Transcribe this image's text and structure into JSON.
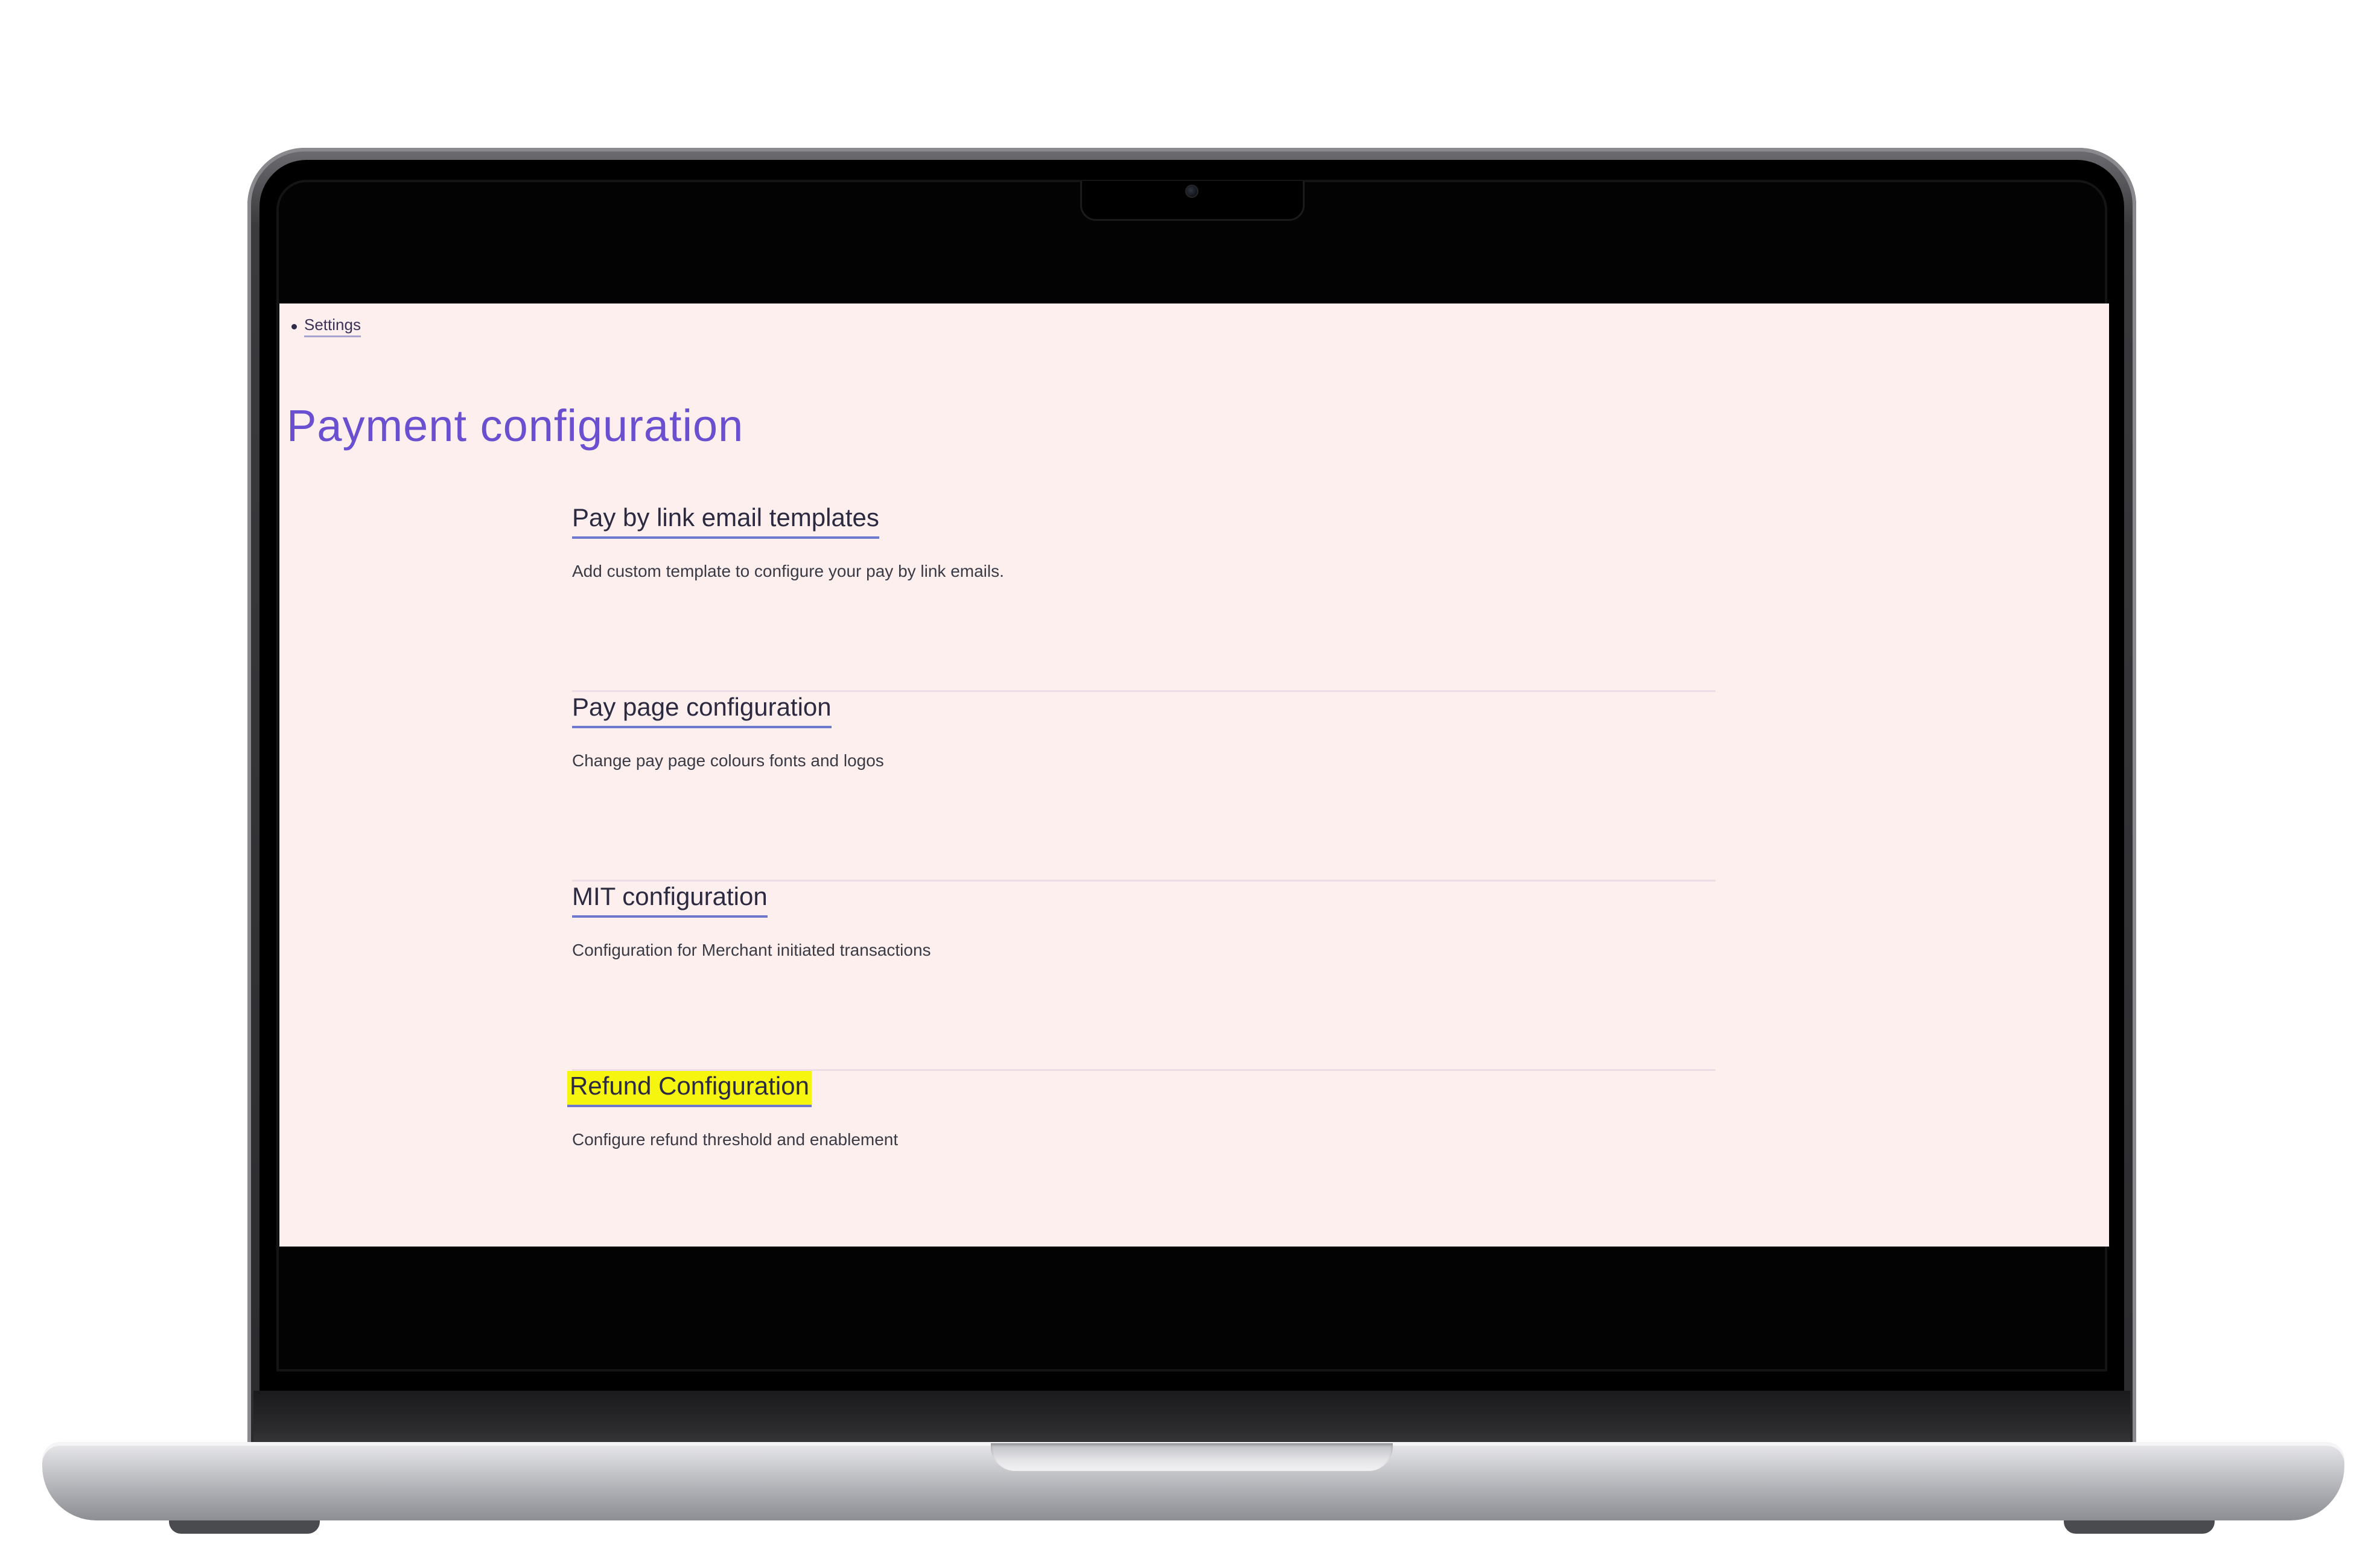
{
  "breadcrumb": {
    "label": "Settings"
  },
  "page": {
    "title": "Payment configuration"
  },
  "items": [
    {
      "title": "Pay by link email templates",
      "description": "Add custom template to configure your pay by link emails."
    },
    {
      "title": "Pay page configuration",
      "description": "Change pay page colours fonts and logos"
    },
    {
      "title": "MIT configuration",
      "description": "Configuration for Merchant initiated transactions"
    },
    {
      "title": "Refund Configuration",
      "description": "Configure refund threshold and enablement",
      "highlighted": true
    }
  ],
  "colors": {
    "screen_background": "#fcefee",
    "title": "#6a4fd0",
    "link_underline": "#6f78cf",
    "highlight": "#f6f50f"
  }
}
